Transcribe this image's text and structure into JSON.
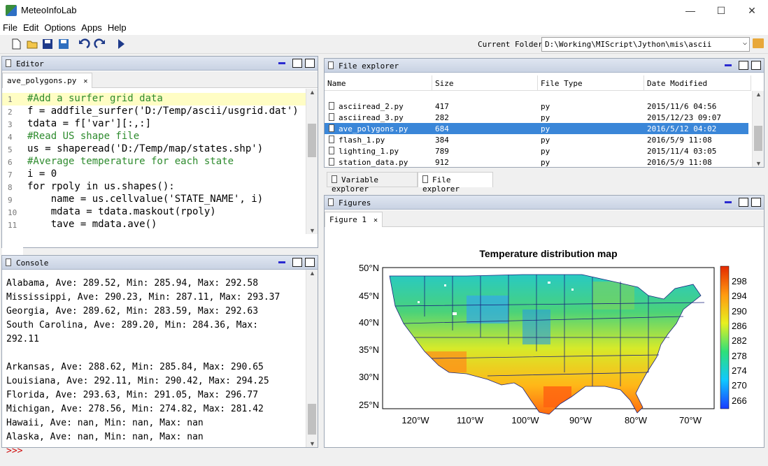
{
  "app": {
    "title": "MeteoInfoLab"
  },
  "menu": [
    "File",
    "Edit",
    "Options",
    "Apps",
    "Help"
  ],
  "toolbar": {
    "current_folder_label": "Current Folder:",
    "current_folder": "D:\\Working\\MIScript\\Jython\\mis\\ascii"
  },
  "editor": {
    "title": "Editor",
    "tab": "ave_polygons.py",
    "lines": [
      {
        "n": "1",
        "text": "#Add a surfer grid data"
      },
      {
        "n": "2",
        "text": "f = addfile_surfer('D:/Temp/ascii/usgrid.dat')"
      },
      {
        "n": "3",
        "text": "tdata = f['var'][:,:]"
      },
      {
        "n": "4",
        "text": "#Read US shape file"
      },
      {
        "n": "5",
        "text": "us = shaperead('D:/Temp/map/states.shp')"
      },
      {
        "n": "6",
        "text": "#Average temperature for each state"
      },
      {
        "n": "7",
        "text": "i = 0"
      },
      {
        "n": "8",
        "text": "for rpoly in us.shapes():"
      },
      {
        "n": "9",
        "text": "    name = us.cellvalue('STATE_NAME', i)"
      },
      {
        "n": "10",
        "text": "    mdata = tdata.maskout(rpoly)"
      },
      {
        "n": "11",
        "text": "    tave = mdata.ave()"
      }
    ]
  },
  "console": {
    "title": "Console",
    "lines": [
      "Alabama, Ave: 289.52, Min: 285.94, Max: 292.58",
      "Mississippi, Ave: 290.23, Min: 287.11, Max: 293.37",
      "Georgia, Ave: 289.62, Min: 283.59, Max: 292.63",
      "South Carolina, Ave: 289.20, Min: 284.36, Max:",
      "292.11",
      "Arkansas, Ave: 288.62, Min: 285.84, Max: 290.65",
      "Louisiana, Ave: 292.11, Min: 290.42, Max: 294.25",
      "Florida, Ave: 293.63, Min: 291.05, Max: 296.77",
      "Michigan, Ave: 278.56, Min: 274.82, Max: 281.42",
      "Hawaii, Ave: nan, Min: nan, Max: nan",
      "Alaska, Ave: nan, Min: nan, Max: nan"
    ],
    "prompt": ">>>"
  },
  "file_explorer": {
    "title": "File explorer",
    "columns": [
      "Name",
      "Size",
      "File Type",
      "Date Modified"
    ],
    "rows": [
      {
        "name": "asciiread_2.py",
        "size": "417",
        "type": "py",
        "date": "2015/11/6 04:56",
        "selected": false
      },
      {
        "name": "asciiread_3.py",
        "size": "282",
        "type": "py",
        "date": "2015/12/23 09:07",
        "selected": false
      },
      {
        "name": "ave_polygons.py",
        "size": "684",
        "type": "py",
        "date": "2016/5/12 04:02",
        "selected": true
      },
      {
        "name": "flash_1.py",
        "size": "384",
        "type": "py",
        "date": "2016/5/9 11:08",
        "selected": false
      },
      {
        "name": "lighting_1.py",
        "size": "789",
        "type": "py",
        "date": "2015/11/4 03:05",
        "selected": false
      },
      {
        "name": "station_data.py",
        "size": "912",
        "type": "py",
        "date": "2016/5/9 11:08",
        "selected": false
      }
    ],
    "bottom_tabs": [
      "Variable explorer",
      "File explorer"
    ]
  },
  "figures": {
    "title": "Figures",
    "tab": "Figure 1",
    "chart_title": "Temperature distribution map",
    "lat_labels": [
      "50°N",
      "45°N",
      "40°N",
      "35°N",
      "30°N",
      "25°N"
    ],
    "lon_labels": [
      "120°W",
      "110°W",
      "100°W",
      "90°W",
      "80°W",
      "70°W"
    ],
    "colorbar_labels": [
      "298",
      "294",
      "290",
      "286",
      "282",
      "278",
      "274",
      "270",
      "266"
    ]
  }
}
